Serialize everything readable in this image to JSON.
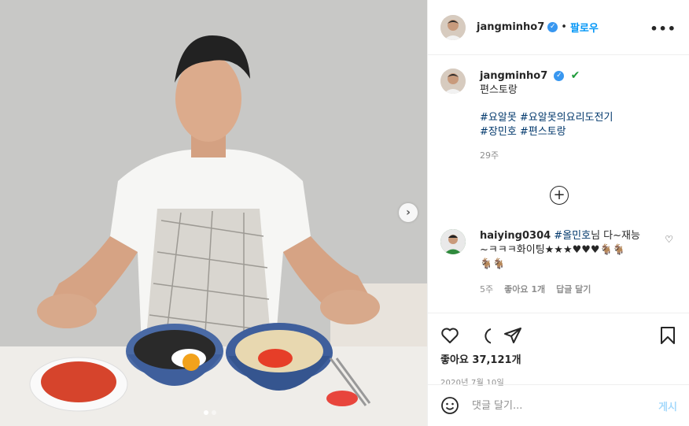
{
  "header": {
    "username": "jangminho7",
    "separator": "•",
    "follow_label": "팔로우",
    "more_icon": "more-icon"
  },
  "caption": {
    "username": "jangminho7",
    "check_emoji": "✔",
    "text": "편스토랑",
    "hashtags": [
      "#요알못 #요알못의요리도전기",
      "#장민호 #편스토랑"
    ],
    "time": "29주"
  },
  "comment": {
    "username": "haiying0304",
    "mention": "#올민호",
    "text_after_mention": "님 다~재능",
    "line2": "~ㅋㅋㅋ화이팅★★★♥♥♥🐐🐐",
    "line3": "🐐🐐",
    "time": "5주",
    "likes": "좋아요 1개",
    "reply": "답글 달기"
  },
  "actions": {
    "likes_label": "좋아요 37,121개",
    "date": "2020년 7월 10일"
  },
  "add_comment": {
    "placeholder": "댓글 달기...",
    "post_label": "게시"
  },
  "carousel": {
    "next_icon": "chevron-right-icon",
    "current_index": 1,
    "total": 2
  },
  "colors": {
    "link_blue": "#0095f6",
    "hashtag": "#00376b",
    "muted": "#8e8e8e",
    "verified": "#3897f0"
  }
}
